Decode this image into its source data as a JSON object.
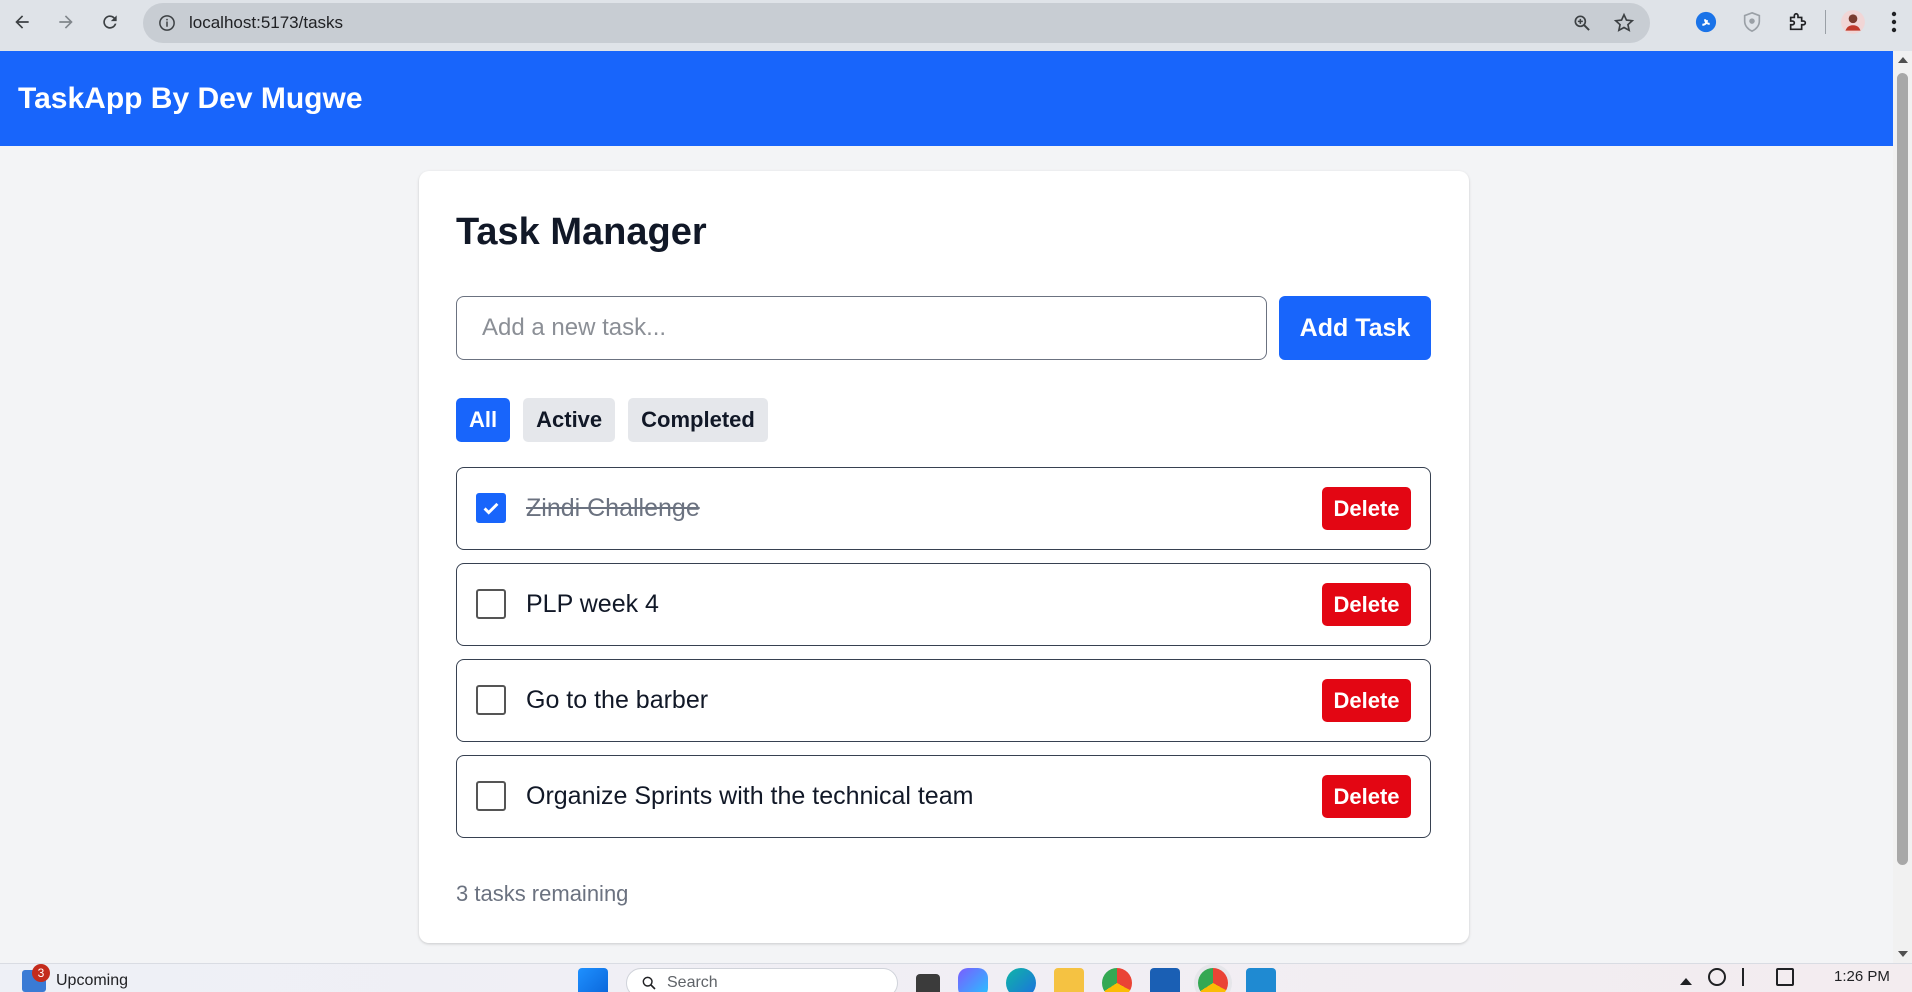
{
  "browser": {
    "url": "localhost:5173/tasks"
  },
  "header": {
    "title": "TaskApp By Dev Mugwe"
  },
  "card": {
    "title": "Task Manager",
    "input_placeholder": "Add a new task...",
    "input_value": "",
    "add_button": "Add Task",
    "filters": [
      {
        "label": "All",
        "active": true
      },
      {
        "label": "Active",
        "active": false
      },
      {
        "label": "Completed",
        "active": false
      }
    ],
    "tasks": [
      {
        "text": "Zindi Challenge",
        "completed": true,
        "delete_label": "Delete"
      },
      {
        "text": "PLP week 4",
        "completed": false,
        "delete_label": "Delete"
      },
      {
        "text": "Go to the barber",
        "completed": false,
        "delete_label": "Delete"
      },
      {
        "text": "Organize Sprints with the technical team",
        "completed": false,
        "delete_label": "Delete"
      }
    ],
    "remaining_text": "3 tasks remaining"
  },
  "taskbar": {
    "widget_badge": "3",
    "widget_label": "Upcoming",
    "search_label": "Search",
    "clock": "1:26 PM"
  },
  "colors": {
    "accent": "#1865fb",
    "danger": "#e30613",
    "page_bg": "#f3f4f6"
  }
}
